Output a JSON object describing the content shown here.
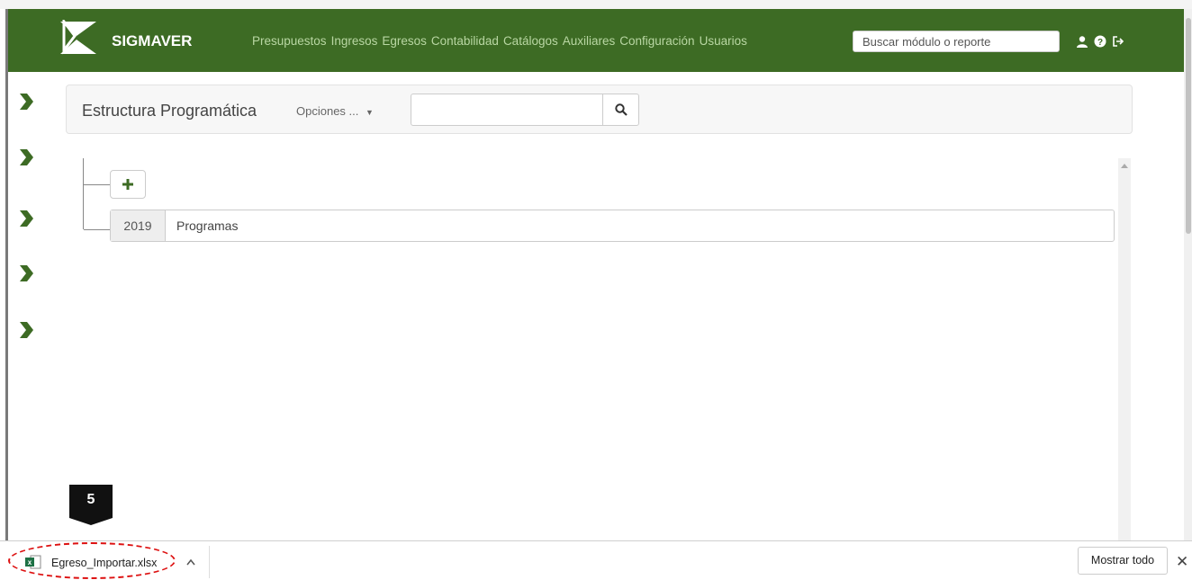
{
  "app": {
    "brand": "SIGMAVER",
    "nav": [
      {
        "label": "Presupuestos"
      },
      {
        "label": "Ingresos"
      },
      {
        "label": "Egresos"
      },
      {
        "label": "Contabilidad"
      },
      {
        "label": "Catálogos"
      },
      {
        "label": "Auxiliares"
      },
      {
        "label": "Configuración"
      },
      {
        "label": "Usuarios"
      }
    ],
    "search_placeholder": "Buscar módulo o reporte",
    "icons": [
      "user-icon",
      "help-icon",
      "logout-icon"
    ]
  },
  "panel": {
    "title": "Estructura Programática",
    "options_label": "Opciones ...",
    "search_value": ""
  },
  "tree": {
    "rows": [
      {
        "year": "2019",
        "label": "Programas"
      }
    ]
  },
  "callout": {
    "number": "5"
  },
  "download_bar": {
    "filename": "Egreso_Importar.xlsx",
    "show_all_label": "Mostrar todo",
    "close_glyph": "✕"
  },
  "colors": {
    "navbar": "#3d6b24",
    "accent": "#3d6b24",
    "callout": "#111111",
    "highlight": "#dd1111"
  }
}
